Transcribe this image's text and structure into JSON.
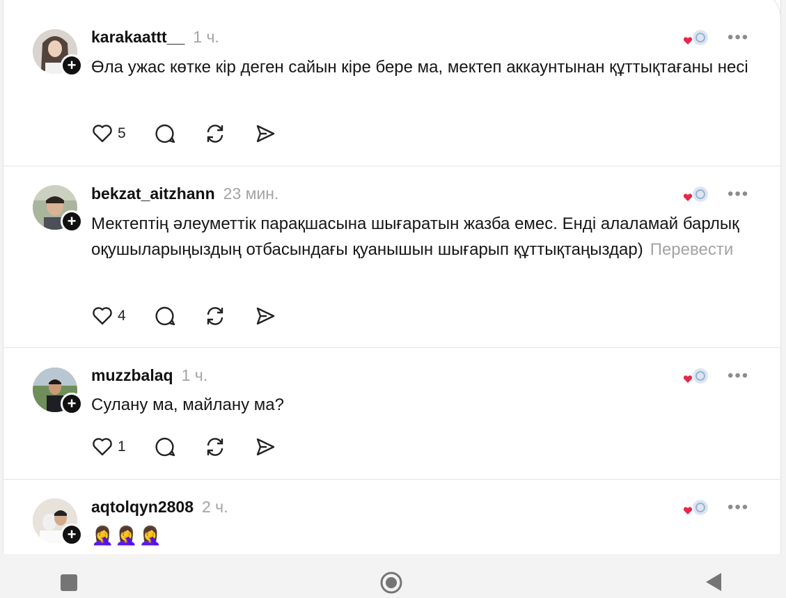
{
  "posts": [
    {
      "username": "karakaattt__",
      "time": "1 ч.",
      "text": "Өла ужас көтке кір деген сайын кіре бере ма, мектеп аккаунтынан құттықтағаны несі",
      "translate": "",
      "likes": "5",
      "more": "•••"
    },
    {
      "username": "bekzat_aitzhann",
      "time": "23 мин.",
      "text": "Мектептің әлеуметтік парақшасына шығаратын жазба емес. Енді алаламай барлық оқушыларыңыздың отбасындағы қуанышын шығарып құттықтаңыздар)",
      "translate": "Перевести",
      "likes": "4",
      "more": "•••"
    },
    {
      "username": "muzzbalaq",
      "time": "1 ч.",
      "text": "Сулану ма, майлану ма?",
      "translate": "",
      "likes": "1",
      "more": "•••"
    },
    {
      "username": "aqtolqyn2808",
      "time": "2 ч.",
      "text": "🤦‍♀️🤦‍♀️🤦‍♀️",
      "translate": "",
      "likes": "",
      "more": "•••"
    }
  ],
  "icons": {
    "like": "heart-outline-icon",
    "reply": "speech-bubble-icon",
    "repost": "repost-arrows-icon",
    "share": "paper-plane-icon",
    "badge": "liked-by-author-icon",
    "follow": "plus-icon"
  },
  "colors": {
    "heart_accent": "#e8264a",
    "muted": "#a3a3a3",
    "text": "#161616"
  },
  "navbar": {
    "recents": "square-recents-icon",
    "home": "circle-home-icon",
    "back": "triangle-back-icon"
  }
}
